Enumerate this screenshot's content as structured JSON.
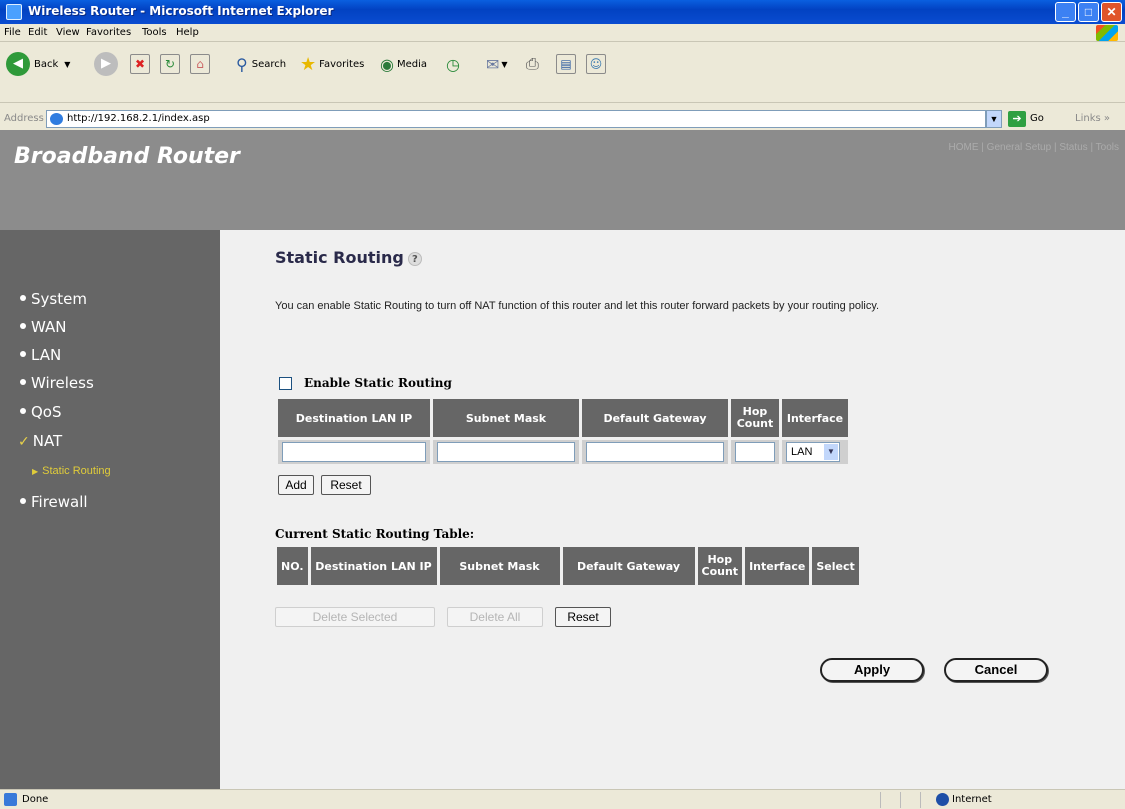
{
  "window": {
    "title": "Wireless Router - Microsoft Internet Explorer"
  },
  "menu": [
    "File",
    "Edit",
    "View",
    "Favorites",
    "Tools",
    "Help"
  ],
  "toolbar": {
    "back": "Back",
    "search": "Search",
    "favorites": "Favorites",
    "media": "Media"
  },
  "address": {
    "label": "Address",
    "url": "http://192.168.2.1/index.asp",
    "go": "Go",
    "links": "Links »"
  },
  "header": {
    "brand": "Broadband Router",
    "topnav": "HOME | General Setup | Status | Tools"
  },
  "sidebar": {
    "items": [
      "System",
      "WAN",
      "LAN",
      "Wireless",
      "QoS",
      "NAT",
      "Firewall"
    ],
    "active": "NAT",
    "subitem": "Static Routing"
  },
  "main": {
    "title": "Static Routing",
    "description": "You can enable Static Routing to turn off NAT function of this router and let this router forward packets by your routing policy.",
    "enable_label": "Enable Static Routing",
    "enable_checked": false,
    "add_table": {
      "headers": [
        "Destination LAN IP",
        "Subnet Mask",
        "Default Gateway",
        "Hop Count",
        "Interface"
      ],
      "interface_value": "LAN"
    },
    "add_button": "Add",
    "reset_button": "Reset",
    "current_title": "Current Static Routing Table:",
    "current_table": {
      "headers": [
        "NO.",
        "Destination LAN IP",
        "Subnet Mask",
        "Default Gateway",
        "Hop Count",
        "Interface",
        "Select"
      ]
    },
    "delete_selected": "Delete Selected",
    "delete_all": "Delete All",
    "reset2": "Reset",
    "apply": "Apply",
    "cancel": "Cancel"
  },
  "status": {
    "left": "Done",
    "zone": "Internet"
  }
}
